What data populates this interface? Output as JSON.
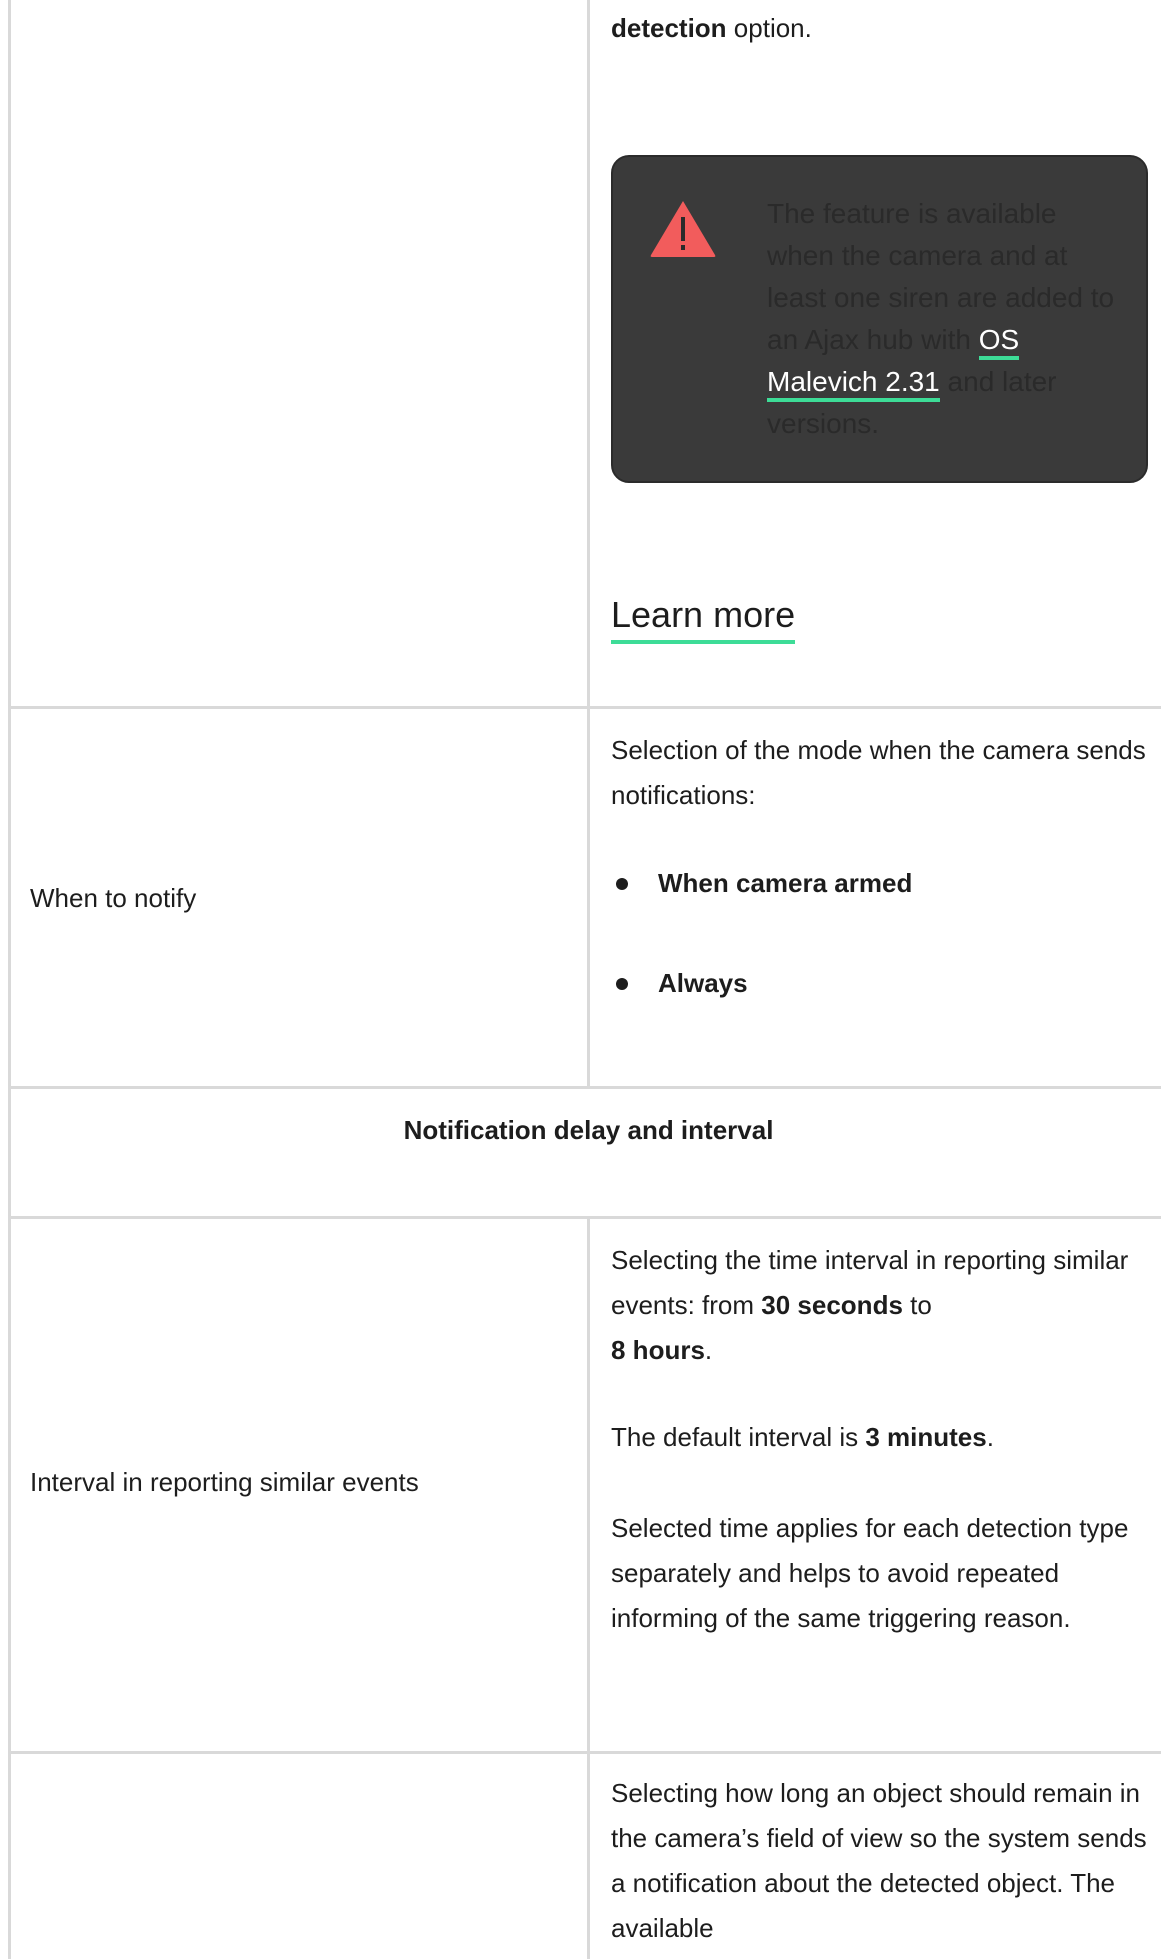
{
  "top": {
    "option_bold": "detection",
    "option_rest": " option."
  },
  "alert": {
    "icon": "warning-triangle-icon",
    "text_before": "The feature is available when the camera and at least one siren are added to an Ajax hub with ",
    "link": "OS Malevich 2.31",
    "text_after": " and later versions."
  },
  "learn_more": "Learn more",
  "rows": {
    "notify": {
      "label": "When to notify",
      "desc": "Selection of the mode when the camera sends notifications:",
      "options": [
        "When camera armed",
        "Always"
      ]
    },
    "section_title": "Notification delay and interval",
    "interval": {
      "label": "Interval in reporting similar events",
      "p1_a": "Selecting the time interval in reporting similar events: from ",
      "p1_b": "30 seconds",
      "p1_c": " to ",
      "p1_d": "8 hours",
      "p1_e": ".",
      "p2_a": "The default interval is ",
      "p2_b": "3 minutes",
      "p2_c": ".",
      "p3": "Selected time applies for each detection type separately and helps to avoid repeated informing of the same triggering reason."
    },
    "duration": {
      "desc": "Selecting how long an object should remain in the camera’s field of view so the system sends a notification about the detected object. The available"
    }
  },
  "colors": {
    "accent": "#3ddc97",
    "alert_bg": "#3a3a3a",
    "warning": "#f25c5c",
    "border": "#d9d9d9"
  }
}
